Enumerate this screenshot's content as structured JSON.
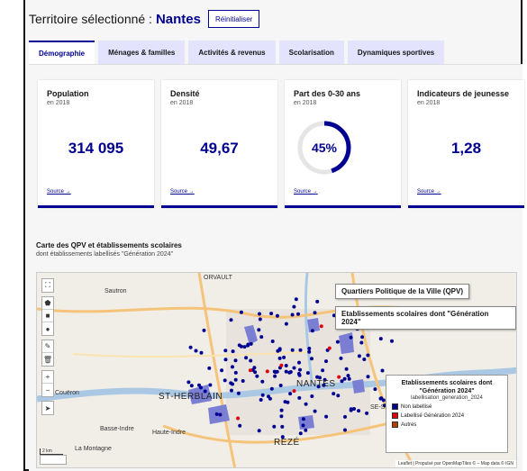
{
  "header": {
    "label": "Territoire sélectionné :",
    "territory": "Nantes",
    "reset_label": "Réinitialiser"
  },
  "tabs": [
    {
      "label": "Démographie",
      "active": true
    },
    {
      "label": "Ménages & familles",
      "active": false
    },
    {
      "label": "Activités & revenus",
      "active": false
    },
    {
      "label": "Scolarisation",
      "active": false
    },
    {
      "label": "Dynamiques sportives",
      "active": false
    }
  ],
  "cards": [
    {
      "title": "Population",
      "sub": "en 2018",
      "value": "314 095",
      "source": "Source →"
    },
    {
      "title": "Densité",
      "sub": "en 2018",
      "value": "49,67",
      "source": "Source →"
    },
    {
      "title": "Part des 0-30 ans",
      "sub": "en 2018",
      "value": "45%",
      "fraction": 0.45,
      "source": "Source →"
    },
    {
      "title": "Indicateurs de jeunesse",
      "sub": "en 2018",
      "value": "1,28",
      "source": "Source →"
    }
  ],
  "map": {
    "title": "Carte des QPV et établissements scolaires",
    "subtitle": "dont établissements labellisés \"Génération 2024\"",
    "layer_qpv": "Quartiers Politique de la Ville (QPV)",
    "layer_schools": "Etablissements scolaires dont \"Génération 2024\"",
    "places": {
      "orvault": "ORVAULT",
      "sautron": "Sautron",
      "nantes": "NANTES",
      "herblain": "ST-HERBLAIN",
      "reze": "REZÉ",
      "coueron": "Couëron",
      "montagne": "La Montagne",
      "basse": "Basse-Indre",
      "indre": "Haute-Indre",
      "stsebastien": "SE-S"
    },
    "legend": {
      "title": "Etablissements scolaires dont \"Génération 2024\"",
      "subtitle": "labellisation_generation_2024",
      "items": [
        {
          "label": "Non labellisé",
          "color": "#000091"
        },
        {
          "label": "Labellisé Génération 2024",
          "color": "#e1000f"
        },
        {
          "label": "Autres",
          "color": "#b34000"
        }
      ]
    },
    "scale": "2 km",
    "attribution": "Leaflet | Propulsé par OpenMapTiles © – Map data © IGN"
  },
  "colors": {
    "primary": "#000091",
    "tab_bg": "#e3e3fd",
    "qpv": "#7b7fd4",
    "road": "#f5c47a"
  }
}
